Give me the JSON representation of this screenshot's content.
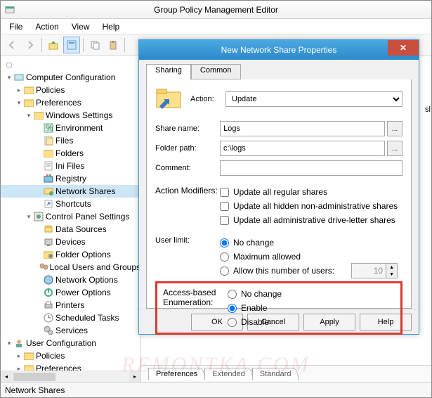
{
  "window": {
    "title": "Group Policy Management Editor"
  },
  "menu": {
    "file": "File",
    "action": "Action",
    "view": "View",
    "help": "Help"
  },
  "tree": {
    "root": "Computer Configuration",
    "policies": "Policies",
    "preferences": "Preferences",
    "winsettings": "Windows Settings",
    "env": "Environment",
    "files": "Files",
    "folders": "Folders",
    "ini": "Ini Files",
    "registry": "Registry",
    "netshares": "Network Shares",
    "shortcuts": "Shortcuts",
    "cp": "Control Panel Settings",
    "datasources": "Data Sources",
    "devices": "Devices",
    "folderopts": "Folder Options",
    "localusers": "Local Users and Groups",
    "netopts": "Network Options",
    "poweropts": "Power Options",
    "printers": "Printers",
    "schedtasks": "Scheduled Tasks",
    "services": "Services",
    "userconfig": "User Configuration",
    "userpolicies": "Policies",
    "userprefs": "Preferences"
  },
  "content_tabs": {
    "preferences": "Preferences",
    "extended": "Extended",
    "standard": "Standard"
  },
  "status": {
    "text": "Network Shares"
  },
  "dialog": {
    "title": "New Network Share Properties",
    "tabs": {
      "sharing": "Sharing",
      "common": "Common"
    },
    "action_label": "Action:",
    "action_value": "Update",
    "share_name_label": "Share name:",
    "share_name_value": "Logs",
    "folder_path_label": "Folder path:",
    "folder_path_value": "c:\\logs",
    "comment_label": "Comment:",
    "comment_value": "",
    "action_modifiers_label": "Action Modifiers:",
    "am1": "Update all regular shares",
    "am2": "Update all hidden non-administrative shares",
    "am3": "Update all administrative drive-letter shares",
    "user_limit_label": "User limit:",
    "ul_nochange": "No change",
    "ul_max": "Maximum allowed",
    "ul_allow": "Allow this number of users:",
    "ul_value": "10",
    "abe_label1": "Access-based",
    "abe_label2": "Enumeration:",
    "abe_nochange": "No change",
    "abe_enable": "Enable",
    "abe_disable": "Disable",
    "buttons": {
      "ok": "OK",
      "cancel": "Cancel",
      "apply": "Apply",
      "help": "Help"
    }
  },
  "watermark": "REMONTKA.COM",
  "sliver": "sl"
}
